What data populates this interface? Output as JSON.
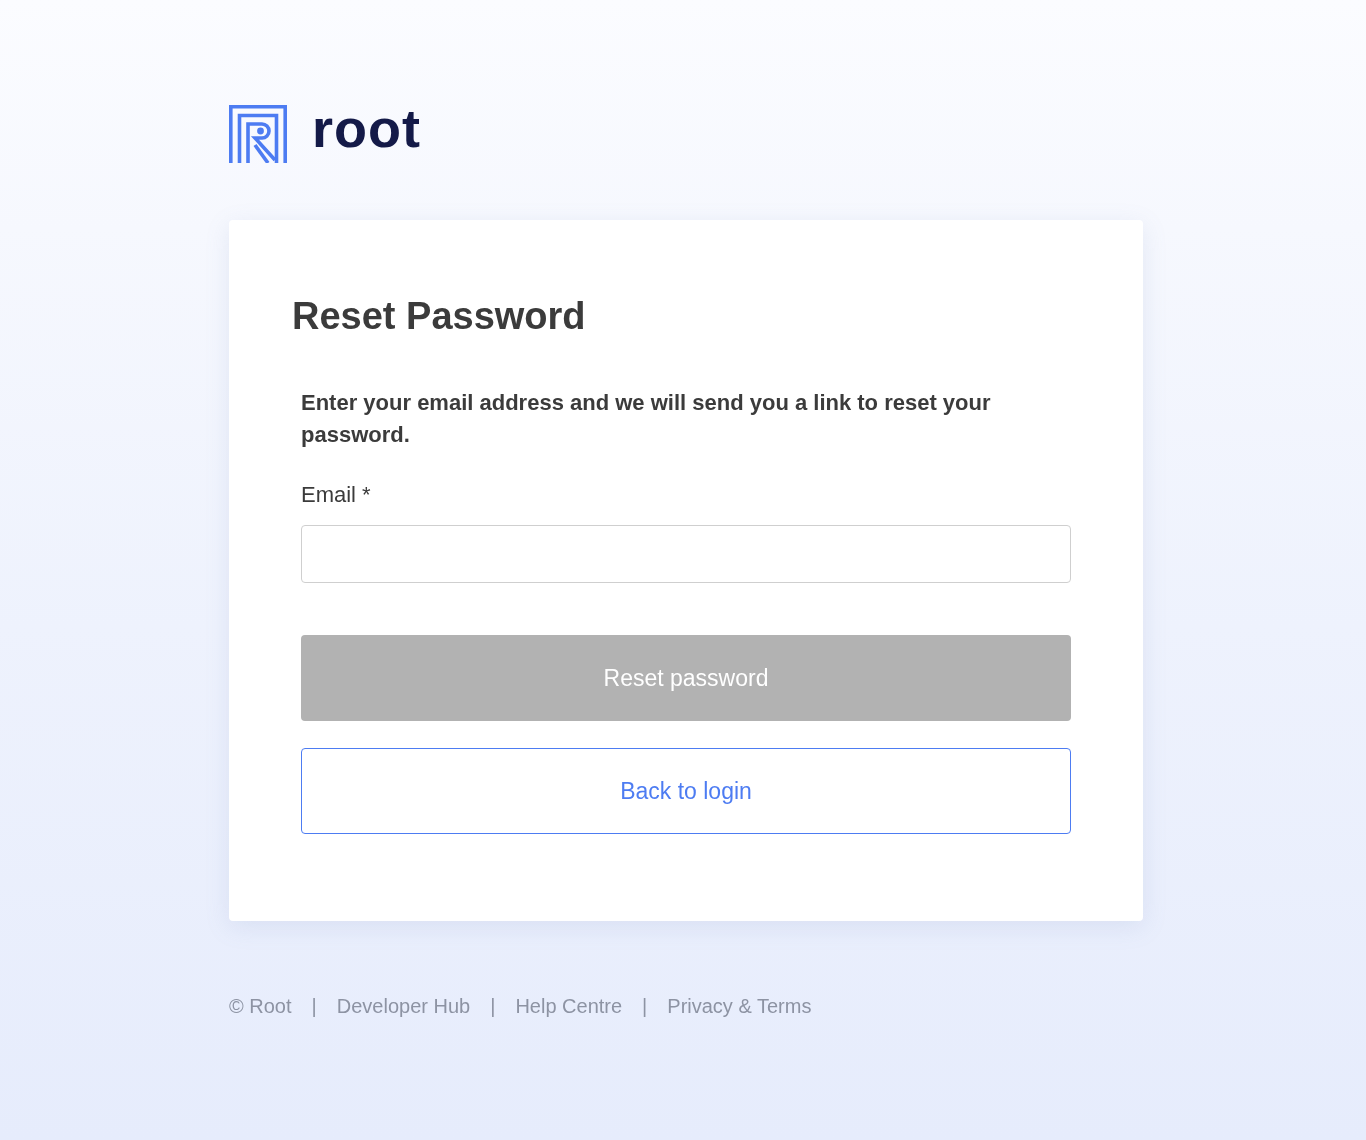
{
  "brand": {
    "name": "root"
  },
  "card": {
    "title": "Reset Password",
    "description": "Enter your email address and we will send you a link to reset your password.",
    "email_field": {
      "label": "Email *"
    },
    "buttons": [
      {
        "kind": "primary",
        "label": "Reset password",
        "disabled": true
      },
      {
        "kind": "outline",
        "label": "Back to login",
        "disabled": false
      }
    ]
  },
  "footer": {
    "copyright": "© Root",
    "links": [
      {
        "separator": "|",
        "label": "Developer Hub"
      },
      {
        "separator": "|",
        "label": "Help Centre"
      },
      {
        "separator": "|",
        "label": "Privacy & Terms"
      }
    ]
  }
}
